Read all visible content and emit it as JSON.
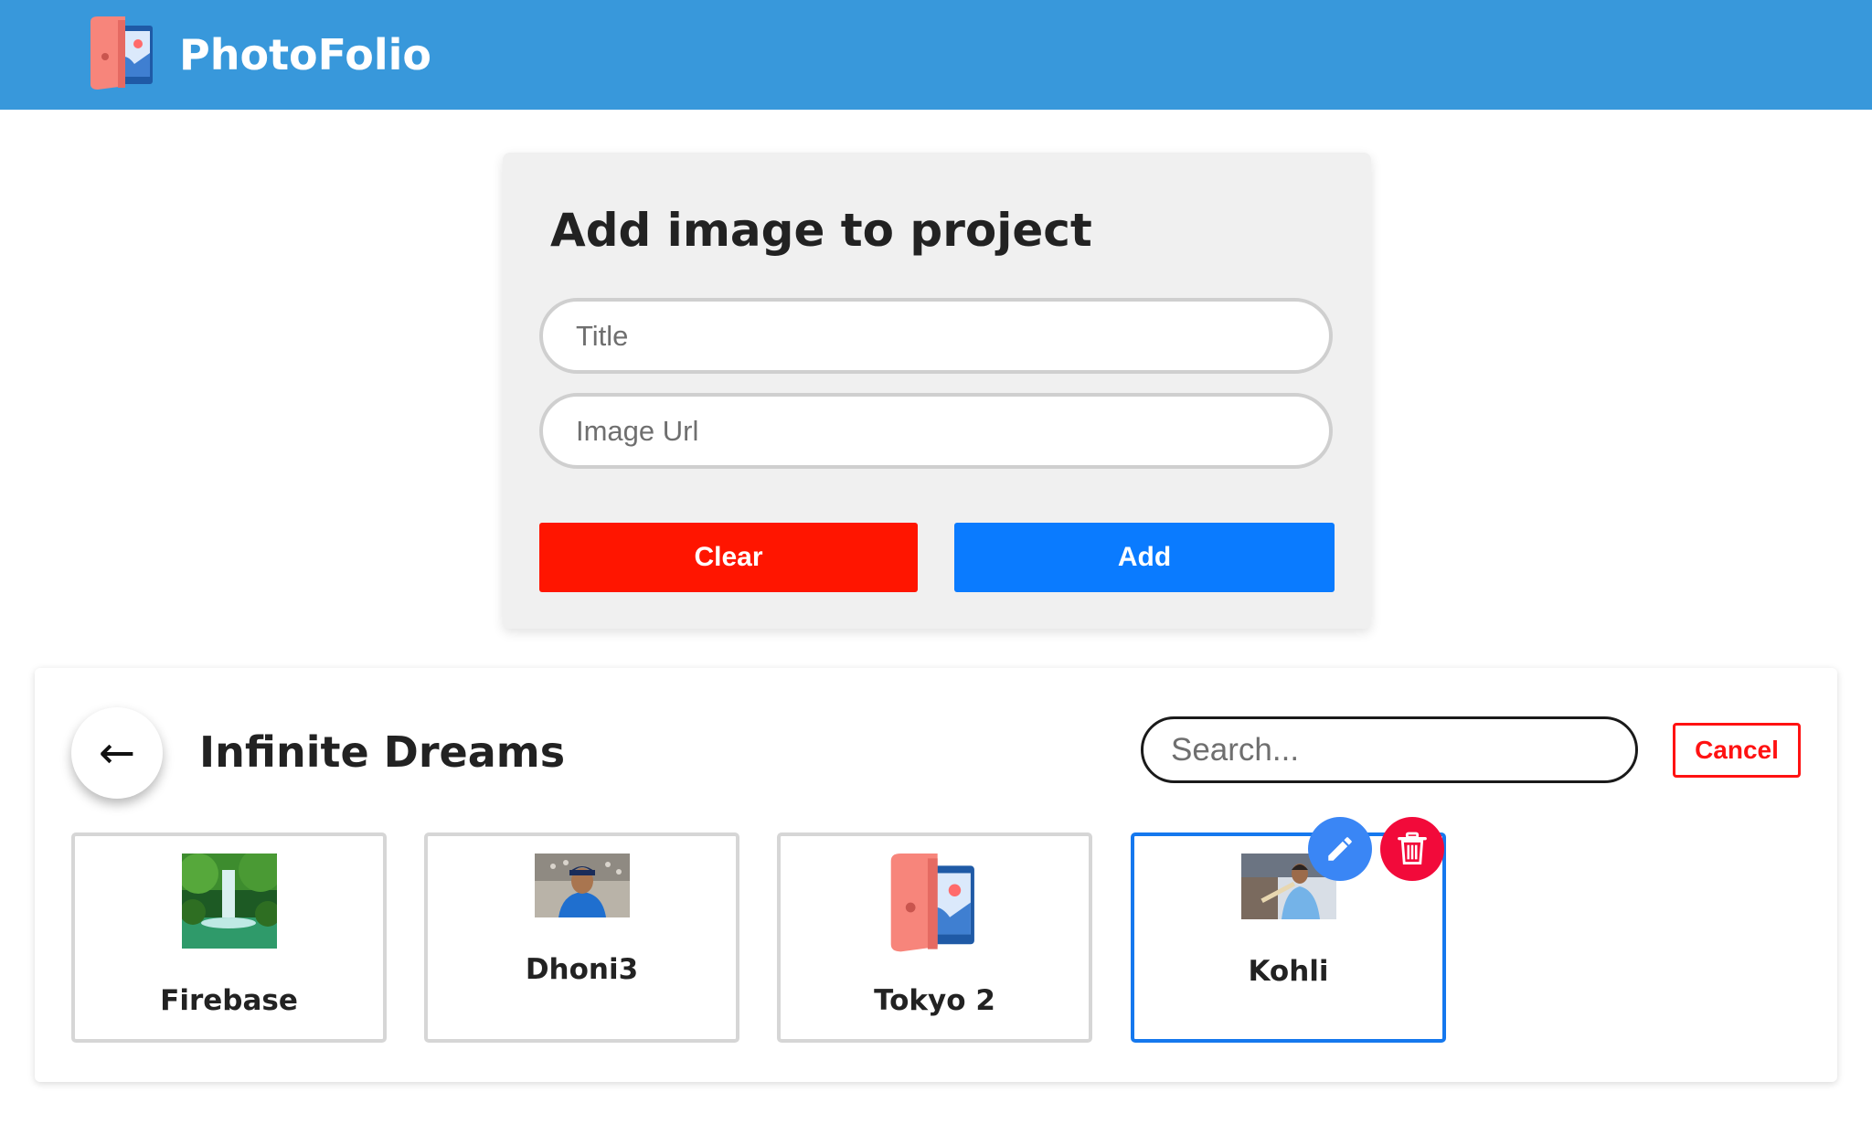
{
  "header": {
    "brand_name": "PhotoFolio",
    "logo_icon": "photofolio-logo-icon",
    "bg_color": "#3898db"
  },
  "form": {
    "title": "Add image to project",
    "title_placeholder": "Title",
    "url_placeholder": "Image Url",
    "clear_label": "Clear",
    "add_label": "Add",
    "clear_color": "#ff1500",
    "add_color": "#0a7bff"
  },
  "album": {
    "back_icon": "←",
    "title": "Infinite Dreams",
    "search_placeholder": "Search...",
    "cancel_label": "Cancel",
    "images": [
      {
        "title": "Firebase",
        "thumb": "waterfall-photo"
      },
      {
        "title": "Dhoni3",
        "thumb": "cricketer-photo"
      },
      {
        "title": "Tokyo 2",
        "thumb": "photofolio-logo-icon"
      },
      {
        "title": "Kohli",
        "thumb": "cricketer-batting-photo",
        "hovered": true,
        "actions": [
          "pencil-icon",
          "trash-icon"
        ]
      }
    ]
  }
}
